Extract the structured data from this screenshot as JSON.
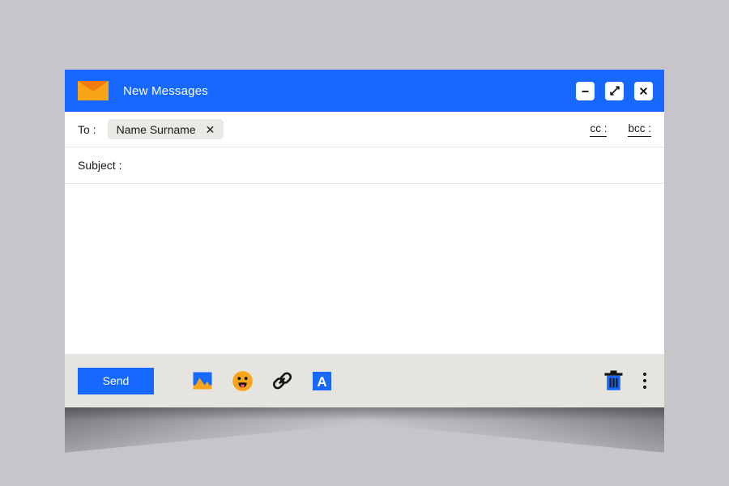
{
  "window": {
    "title": "New Messages",
    "logo_icon": "envelope-icon",
    "controls": [
      {
        "name": "minimize",
        "icon": "minimize-icon",
        "label": "−"
      },
      {
        "name": "expand",
        "icon": "expand-diagonal-icon",
        "label": "↗"
      },
      {
        "name": "close",
        "icon": "close-icon",
        "label": "×"
      }
    ]
  },
  "compose": {
    "to_label": "To :",
    "recipient": {
      "name": "Name Surname",
      "remove_label": "✕"
    },
    "cc_label": "cc :",
    "bcc_label": "bcc :",
    "subject_label": "Subject :",
    "subject_value": "",
    "body_value": "",
    "body_placeholder": ""
  },
  "toolbar": {
    "send_label": "Send",
    "tools": [
      {
        "name": "insert-image",
        "icon": "image-icon"
      },
      {
        "name": "insert-emoji",
        "icon": "emoji-icon"
      },
      {
        "name": "insert-link",
        "icon": "link-icon"
      },
      {
        "name": "formatting-options",
        "icon": "font-format-icon"
      }
    ],
    "discard": {
      "name": "discard-draft",
      "icon": "trash-icon"
    },
    "more": {
      "name": "more-options",
      "icon": "kebab-menu-icon"
    }
  },
  "colors": {
    "accent_blue": "#1668fe",
    "envelope_orange": "#f9a51a",
    "envelope_flap": "#f07d12",
    "page_background": "#c6c6ca",
    "footer_background": "#e5e4df",
    "chip_background": "#e9e9e5"
  }
}
